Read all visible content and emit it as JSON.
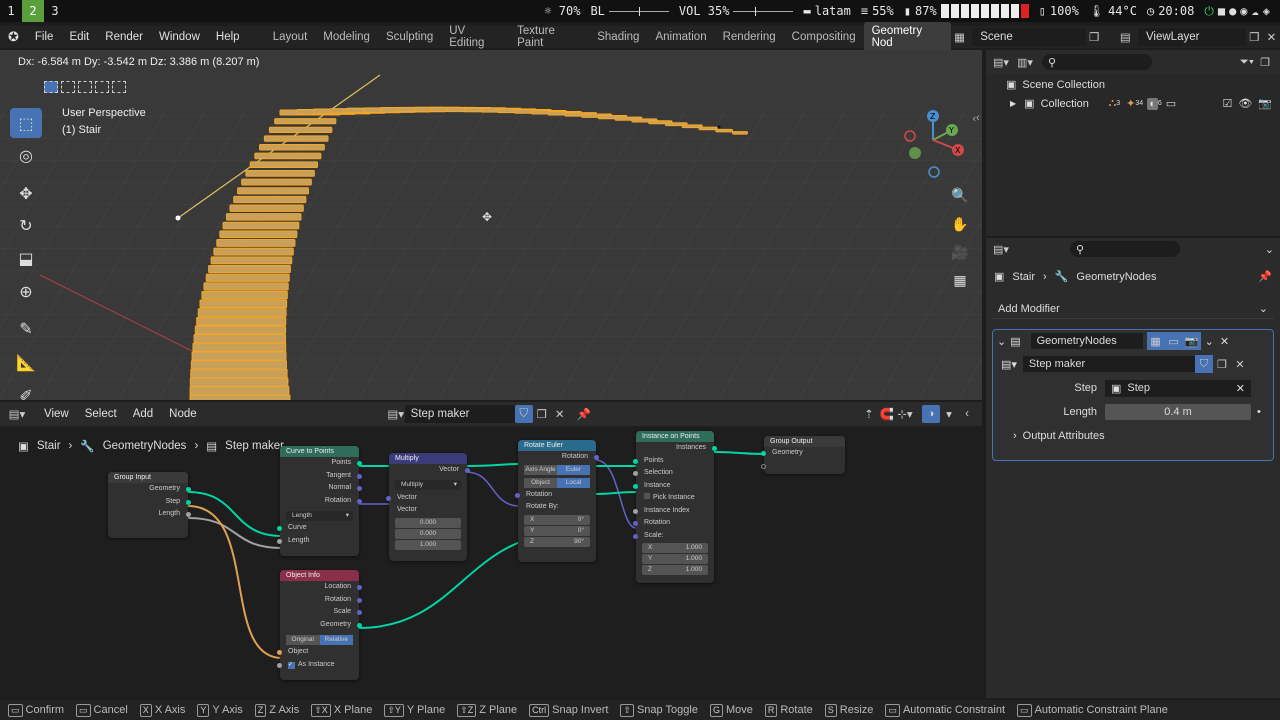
{
  "sysbar": {
    "workspaces": [
      "1",
      "2",
      "3"
    ],
    "brightness": "☼ 70%",
    "bl": "BL",
    "vol": "VOL 35%",
    "layout": "latam",
    "disk": "55%",
    "battery_bar": "87%",
    "battery": "100%",
    "temp": "44°C",
    "time": "20:08"
  },
  "menu": [
    "File",
    "Edit",
    "Render",
    "Window",
    "Help"
  ],
  "workspace_tabs": [
    "Layout",
    "Modeling",
    "Sculpting",
    "UV Editing",
    "Texture Paint",
    "Shading",
    "Animation",
    "Rendering",
    "Compositing",
    "Geometry Nod"
  ],
  "scene": "Scene",
  "view_layer": "ViewLayer",
  "viewport": {
    "transform_info": "Dx: -6.584 m   Dy: -3.542 m   Dz: 3.386 m (8.207 m)",
    "perspective": "User Perspective",
    "object": "(1) Stair"
  },
  "node_header": {
    "menus": [
      "View",
      "Select",
      "Add",
      "Node"
    ],
    "tree_name": "Step maker"
  },
  "breadcrumb": [
    "Stair",
    "GeometryNodes",
    "Step maker"
  ],
  "nodes": {
    "group_input": {
      "title": "Group Input",
      "outputs": [
        "Geometry",
        "Step",
        "Length"
      ]
    },
    "curve_to_points": {
      "title": "Curve to Points",
      "outputs": [
        "Points",
        "Tangent",
        "Normal",
        "Rotation"
      ],
      "mode": "Length",
      "inputs": [
        "Curve",
        "Length"
      ]
    },
    "multiply": {
      "title": "Multiply",
      "output": "Vector",
      "op": "Multiply",
      "inputs": [
        "Vector",
        "Vector"
      ],
      "values": [
        "0.000",
        "0.000",
        "1.000"
      ]
    },
    "rotate_euler": {
      "title": "Rotate Euler",
      "output": "Rotation",
      "seg1": [
        "Axis Angle",
        "Euler"
      ],
      "seg2": [
        "Object",
        "Local"
      ],
      "inputs": [
        "Rotation",
        "Rotate By:"
      ],
      "x": "0°",
      "y": "0°",
      "z": "90°",
      "labels": [
        "X",
        "Y",
        "Z"
      ]
    },
    "instance_on_points": {
      "title": "Instance on Points",
      "output": "Instances",
      "inputs": [
        "Points",
        "Selection",
        "Instance",
        "Pick Instance",
        "Instance Index",
        "Rotation",
        "Scale:"
      ],
      "scale": [
        "1.000",
        "1.000",
        "1.000"
      ],
      "labels": [
        "X",
        "Y",
        "Z"
      ]
    },
    "group_output": {
      "title": "Group Output",
      "inputs": [
        "Geometry"
      ]
    },
    "object_info": {
      "title": "Object Info",
      "outputs": [
        "Location",
        "Rotation",
        "Scale",
        "Geometry"
      ],
      "seg": [
        "Original",
        "Relative"
      ],
      "inputs": [
        "Object"
      ],
      "as_instance": "As Instance"
    }
  },
  "outliner": {
    "scene_collection": "Scene Collection",
    "collection": "Collection",
    "counts": [
      "3",
      "34",
      "6"
    ]
  },
  "properties": {
    "breadcrumb": [
      "Stair",
      "GeometryNodes"
    ],
    "add_modifier": "Add Modifier",
    "modifier_name": "GeometryNodes",
    "node_group": "Step maker",
    "step_label": "Step",
    "step_value": "Step",
    "length_label": "Length",
    "length_value": "0.4 m",
    "output_attributes": "Output Attributes"
  },
  "status": [
    {
      "key": "",
      "label": "Confirm"
    },
    {
      "key": "",
      "label": "Cancel"
    },
    {
      "key": "X",
      "label": "X Axis"
    },
    {
      "key": "Y",
      "label": "Y Axis"
    },
    {
      "key": "Z",
      "label": "Z Axis"
    },
    {
      "key": "⇧X",
      "label": "X Plane"
    },
    {
      "key": "⇧Y",
      "label": "Y Plane"
    },
    {
      "key": "⇧Z",
      "label": "Z Plane"
    },
    {
      "key": "Ctrl",
      "label": "Snap Invert"
    },
    {
      "key": "⇧",
      "label": "Snap Toggle"
    },
    {
      "key": "G",
      "label": "Move"
    },
    {
      "key": "R",
      "label": "Rotate"
    },
    {
      "key": "S",
      "label": "Resize"
    },
    {
      "key": "",
      "label": "Automatic Constraint"
    },
    {
      "key": "",
      "label": "Automatic Constraint Plane"
    }
  ],
  "colors": {
    "accent": "#4772b3",
    "geometry_socket": "#00d6a3",
    "vector_socket": "#6363c7",
    "selection": "#f5a623"
  }
}
